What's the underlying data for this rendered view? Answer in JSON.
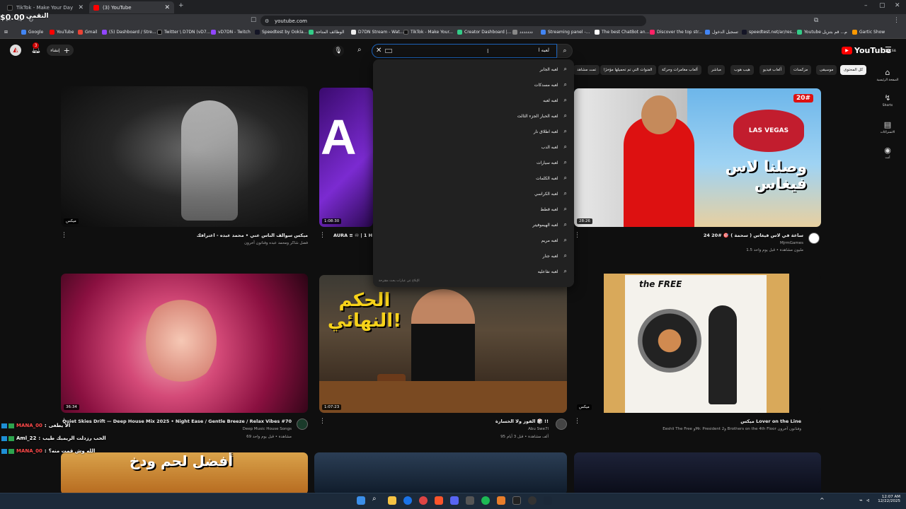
{
  "browser": {
    "tabs": [
      {
        "title": "TikTok - Make Your Day",
        "active": false
      },
      {
        "title": "(3) YouTube",
        "active": true
      }
    ],
    "new_tab": "+",
    "url": "youtube.com",
    "window_controls": [
      "–",
      "▢",
      "✕"
    ],
    "bookmarks": [
      "Google",
      "YouTube",
      "Gmail",
      "(5) Dashboard / Stre...",
      "Twitter \\ D7DN (vD7...",
      "vD7DN - Twitch",
      "Speedtest by Ookla...",
      "الوظائف المتاحة",
      "D7DN Stream - Wat...",
      "TikTok - Make Your...",
      "Creator Dashboard |...",
      "ددددددد",
      "Streaming panel -...",
      "The best ChatBot an...",
      "Discover the top str...",
      "تسجيل الدخول",
      "speedtest.net/ar/res...",
      "Youtube م... قم بتنزيل",
      "Gartic Show"
    ]
  },
  "overlay": {
    "balance_label": "النقمي",
    "balance_value": "$0.00"
  },
  "youtube": {
    "logo_text": "YouTube",
    "logo_sup": "SA",
    "create_label": "إنشاء",
    "notif_count": "3",
    "search_value": "لعبه ا",
    "chips": [
      {
        "label": "كل المحتوى",
        "selected": true
      },
      {
        "label": "موسيقى",
        "selected": false
      },
      {
        "label": "مزكسات",
        "selected": false
      },
      {
        "label": "ألعاب فيديو",
        "selected": false
      },
      {
        "label": "هيب هوب",
        "selected": false
      },
      {
        "label": "مباشر",
        "selected": false
      },
      {
        "label": "ألعاب مغامرات وحركة",
        "selected": false
      },
      {
        "label": "الفنوات التي تم تحميلها مؤخرًا",
        "selected": false
      },
      {
        "label": "تمت مشاهد",
        "selected": false
      }
    ],
    "sidenav": [
      {
        "icon": "⌂",
        "label": "الصفحة الرئيسية"
      },
      {
        "icon": "↯",
        "label": "Shorts"
      },
      {
        "icon": "▤",
        "label": "الاشتراكات"
      },
      {
        "icon": "◉",
        "label": "أنت"
      }
    ],
    "suggestions": [
      "لعبه الجابر",
      "لعبه مسدكات",
      "لعبه لعبه",
      "لعبه الحبار الجزء الثالث",
      "لعبه اطلاق نار",
      "لعبه الدب",
      "لعبه سيارات",
      "لعبه الكلمات",
      "لعبه الكراسي",
      "لعبه قطط",
      "لعبه الهيموفيتر",
      "لعبه مريم",
      "لعبه جنار",
      "لعبه نفاعليه"
    ],
    "report_text": "الإبلاغ عن عبارات بحث مقترحة",
    "videos": [
      {
        "title": "ميكس سوالف الناس عني • محمد عبده - اعترافك",
        "meta1": "فضل شاكر ومحمد عبده وفنانون آخرون",
        "meta2": "",
        "badge": "ميكس"
      },
      {
        "title": "AURA ≡ ♾ | 1 H",
        "meta1": "",
        "meta2": "",
        "badge": "1:08:30"
      },
      {
        "title": "24 ساعة في لاس فيغاس ( سحمة ) 🎯 #20",
        "meta1": "MjrmGames",
        "meta2": "1.5 مليون مشاهدة • قبل يوم واحد",
        "badge": "28:26",
        "thumb_text": "وصلنا لاس فيغاس",
        "tag": "20#"
      },
      {
        "title": "Quiet Skies Drift — Deep House Mix 2025 • Night Ease / Gentle Breeze / Relax Vibes #70",
        "meta1": "Deep Music House Songs",
        "meta2": "69 مشاهدة • قبل يوم واحد",
        "badge": "36:34"
      },
      {
        "title": "الفوز ولا الخسارة 🎲 !!",
        "meta1": "Abu Swe7l",
        "meta2": "95 ألف مشاهدة • قبل 3 أيام",
        "badge": "1:07:23",
        "thumb_text": "الحكم النهائي!"
      },
      {
        "title": "ميكس Lover on the Line",
        "meta1": "Eeshii The Free وMr. President و2 Brothers on the 4th Floor وفنانون آخرون",
        "meta2": "",
        "badge": "ميكس",
        "thumb_text": "the FREE"
      },
      {
        "title": "",
        "meta1": "",
        "meta2": "",
        "thumb_text": "أفضل لحم ودخ"
      }
    ]
  },
  "chat": [
    {
      "user": "MANA_00",
      "msg": "الا يطغى"
    },
    {
      "user": "Aml_22",
      "msg": "الحب رزدلت الريمبك طيب"
    },
    {
      "user": "MANA_00",
      "msg": "الله وش قمت منه؟"
    }
  ],
  "taskbar": {
    "time": "12:07 AM",
    "date": "12/22/2025"
  }
}
